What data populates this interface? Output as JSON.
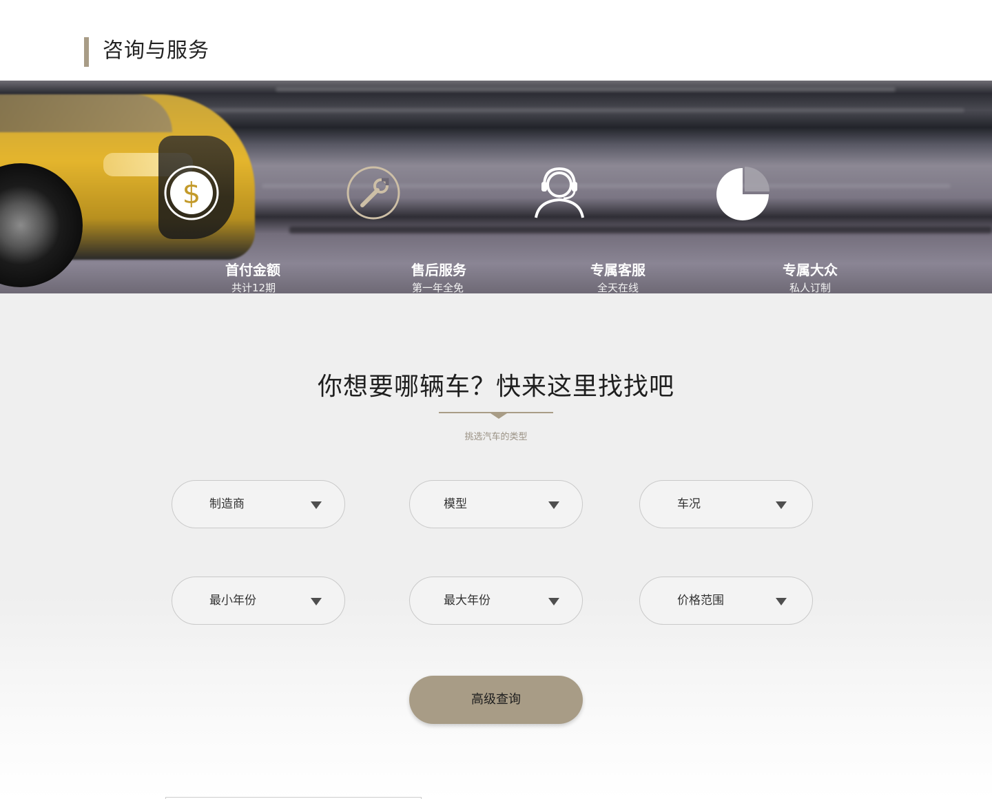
{
  "header": {
    "title": "咨询与服务"
  },
  "banner": {
    "features": [
      {
        "icon": "dollar-circle-icon",
        "title": "首付金额",
        "subtitle": "共计12期"
      },
      {
        "icon": "wrench-circle-icon",
        "title": "售后服务",
        "subtitle": "第一年全免"
      },
      {
        "icon": "headset-agent-icon",
        "title": "专属客服",
        "subtitle": "全天在线"
      },
      {
        "icon": "pie-chart-icon",
        "title": "专属大众",
        "subtitle": "私人订制"
      }
    ]
  },
  "search": {
    "title": "你想要哪辆车？快来这里找找吧",
    "subtitle": "挑选汽车的类型",
    "filters": [
      {
        "label": "制造商"
      },
      {
        "label": "模型"
      },
      {
        "label": "车况"
      },
      {
        "label": "最小年份"
      },
      {
        "label": "最大年份"
      },
      {
        "label": "价格范围"
      }
    ],
    "advanced_button": "高级查询"
  },
  "colors": {
    "accent": "#a89c86",
    "title_text": "#222222",
    "section_bg": "#efefef"
  }
}
